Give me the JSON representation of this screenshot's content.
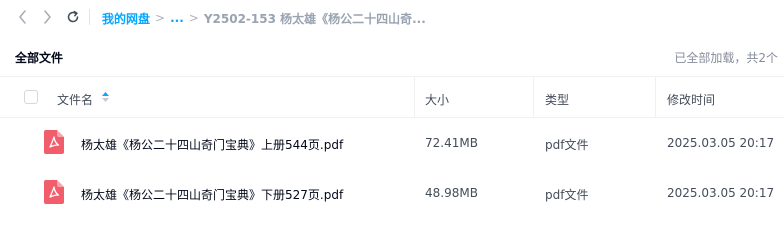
{
  "toolbar": {
    "back_icon": "chevron-left-icon",
    "forward_icon": "chevron-right-icon",
    "refresh_icon": "refresh-icon"
  },
  "breadcrumb": {
    "root": "我的网盘",
    "ellipsis": "...",
    "current": "Y2502-153 杨太雄《杨公二十四山奇..."
  },
  "section": {
    "title": "全部文件",
    "loaded_status": "已全部加载，共2个"
  },
  "columns": {
    "name": "文件名",
    "size": "大小",
    "type": "类型",
    "modified": "修改时间"
  },
  "files": [
    {
      "name": "杨太雄《杨公二十四山奇门宝典》上册544页.pdf",
      "size": "72.41MB",
      "type": "pdf文件",
      "modified": "2025.03.05 20:17",
      "icon": "pdf-file-icon"
    },
    {
      "name": "杨太雄《杨公二十四山奇门宝典》下册527页.pdf",
      "size": "48.98MB",
      "type": "pdf文件",
      "modified": "2025.03.05 20:17",
      "icon": "pdf-file-icon"
    }
  ],
  "colors": {
    "accent": "#06a7ff",
    "pdf_red": "#f25d6b",
    "text_primary": "#03081a",
    "text_secondary": "#454d5a",
    "text_muted": "#878c9c"
  }
}
